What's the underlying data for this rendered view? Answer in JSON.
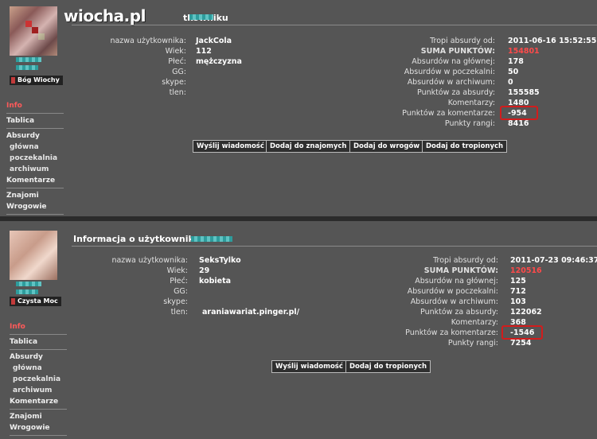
{
  "site": {
    "logo": "wiocha.pl"
  },
  "profiles": [
    {
      "header": {
        "title": "Informacja o użytkowniku"
      },
      "rank_badge": "Bóg Wiochy",
      "nav": {
        "info": "Info",
        "tablica": "Tablica",
        "absurdy": "Absurdy",
        "glowna": "główna",
        "poczekalnia": "poczekalnia",
        "archiwum": "archiwum",
        "komentarze": "Komentarze",
        "znajomi": "Znajomi",
        "wrogowie": "Wrogowie"
      },
      "fields": {
        "nazwa_label": "nazwa użytkownika:",
        "nazwa": "JackCola",
        "wiek_label": "Wiek:",
        "wiek": "112",
        "plec_label": "Płeć:",
        "plec": "mężczyzna",
        "gg_label": "GG:",
        "skype_label": "skype:",
        "tlen_label": "tlen:",
        "tlen": ""
      },
      "stats": {
        "tropi_label": "Tropi absurdy od:",
        "tropi": "2011-06-16 15:52:55",
        "suma_label": "SUMA PUNKTÓW:",
        "suma": "154801",
        "glowna_label": "Absurdów na głównej:",
        "glowna": "178",
        "poczekalnia_label": "Absurdów w poczekalni:",
        "poczekalnia": "50",
        "archiwum_label": "Absurdów w archiwum:",
        "archiwum": "0",
        "pkt_absurdy_label": "Punktów za absurdy:",
        "pkt_absurdy": "155585",
        "komentarze_label": "Komentarzy:",
        "komentarze": "1480",
        "pkt_koment_label": "Punktów za komentarze:",
        "pkt_koment": "-954",
        "rangi_label": "Punkty rangi:",
        "rangi": "8416"
      },
      "buttons": {
        "msg": "Wyślij wiadomość",
        "friend": "Dodaj do znajomych",
        "enemy": "Dodaj do wrogów",
        "track": "Dodaj do tropionych"
      }
    },
    {
      "header": {
        "title": "Informacja o użytkowniku"
      },
      "rank_badge": "Czysta Moc",
      "nav": {
        "info": "Info",
        "tablica": "Tablica",
        "absurdy": "Absurdy",
        "glowna": "główna",
        "poczekalnia": "poczekalnia",
        "archiwum": "archiwum",
        "komentarze": "Komentarze",
        "znajomi": "Znajomi",
        "wrogowie": "Wrogowie"
      },
      "fields": {
        "nazwa_label": "nazwa użytkownika:",
        "nazwa": "SeksTylko",
        "wiek_label": "Wiek:",
        "wiek": "29",
        "plec_label": "Płeć:",
        "plec": "kobieta",
        "gg_label": "GG:",
        "skype_label": "skype:",
        "tlen_label": "tlen:",
        "tlen": "araniawariat.pinger.pl/"
      },
      "stats": {
        "tropi_label": "Tropi absurdy od:",
        "tropi": "2011-07-23 09:46:37",
        "suma_label": "SUMA PUNKTÓW:",
        "suma": "120516",
        "glowna_label": "Absurdów na głównej:",
        "glowna": "125",
        "poczekalnia_label": "Absurdów w poczekalni:",
        "poczekalnia": "712",
        "archiwum_label": "Absurdów w archiwum:",
        "archiwum": "103",
        "pkt_absurdy_label": "Punktów za absurdy:",
        "pkt_absurdy": "122062",
        "komentarze_label": "Komentarzy:",
        "komentarze": "368",
        "pkt_koment_label": "Punktów za komentarze:",
        "pkt_koment": "-1546",
        "rangi_label": "Punkty rangi:",
        "rangi": "7254"
      },
      "buttons": {
        "msg": "Wyślij wiadomość",
        "track": "Dodaj do tropionych"
      }
    }
  ],
  "colors": {
    "background": "#555555",
    "active_nav": "#ff5a5a",
    "highlight": "#d21c1c",
    "suma_value": "#ff4a4a"
  }
}
